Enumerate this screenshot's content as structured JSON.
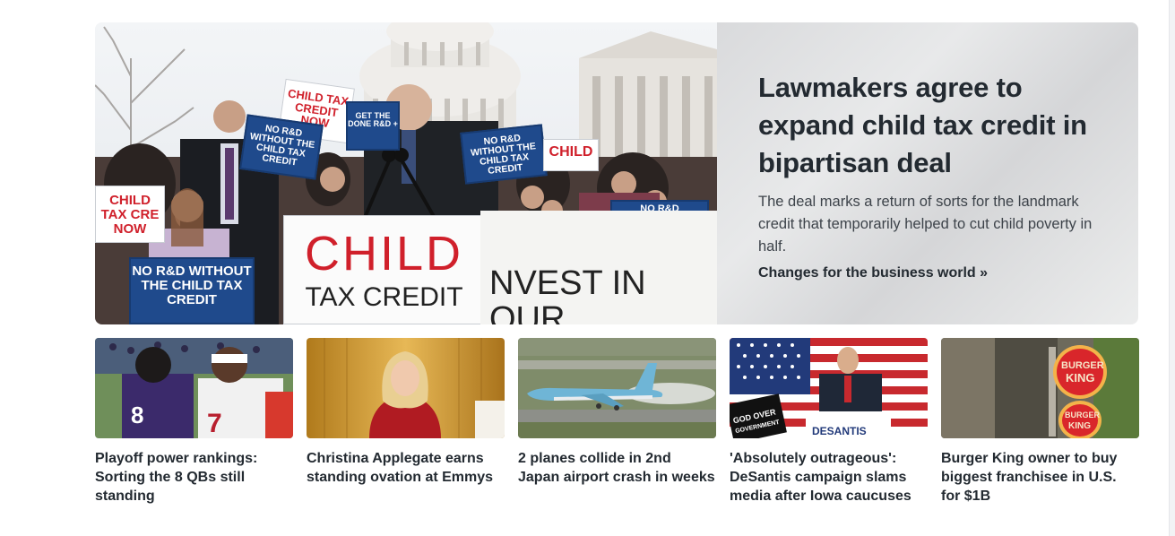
{
  "hero": {
    "title": "Lawmakers agree to expand child tax credit in bipartisan deal",
    "summary": "The deal marks a return of sorts for the landmark credit that temporarily helped to cut child poverty in half.",
    "link_label": "Changes for the business world »",
    "image_signs": {
      "child_tax_credit_big": "CHILD",
      "child_tax_credit_big_sub": "TAX CREDIT",
      "no_rd_1": "NO R&D WITHOUT THE CHILD TAX CREDIT",
      "no_rd_2": "NO R&D WITHOUT THE CHILD TAX CREDIT",
      "no_rd_3": "NO R&D WITHOUT THE CHILD TAX CREDIT",
      "child_tax_credit_now": "CHILD TAX CREDIT NOW",
      "get_done": "GET THE DONE R&D +",
      "child_left": "CHILD TAX CRE NOW",
      "child_right": "CHILD",
      "no_rd_right": "NO R&D",
      "invest_banner": "NVEST IN OUR"
    }
  },
  "stories": [
    {
      "title": "Playoff power rankings: Sorting the 8 QBs still standing",
      "image": "football-players-photo"
    },
    {
      "title": "Christina Applegate earns standing ovation at Emmys",
      "image": "emmys-stage-photo"
    },
    {
      "title": "2 planes collide in 2nd Japan airport crash in weeks",
      "image": "airplane-runway-photo"
    },
    {
      "title": "'Absolutely outrageous': DeSantis campaign slams media after Iowa caucuses",
      "image": "campaign-podium-photo",
      "image_signs": {
        "god_over_government": "GOD OVER GOVERNMENT",
        "podium": "DESANTIS"
      }
    },
    {
      "title": "Burger King owner to buy biggest franchisee in U.S. for $1B",
      "image": "burger-king-sign-photo",
      "image_signs": {
        "logo_top": "BURGER KING",
        "logo_bottom": "BURGER KING"
      }
    }
  ],
  "colors": {
    "text": "#232a31",
    "summary": "#3d434a",
    "hero_panel": "#e0e1e3"
  }
}
